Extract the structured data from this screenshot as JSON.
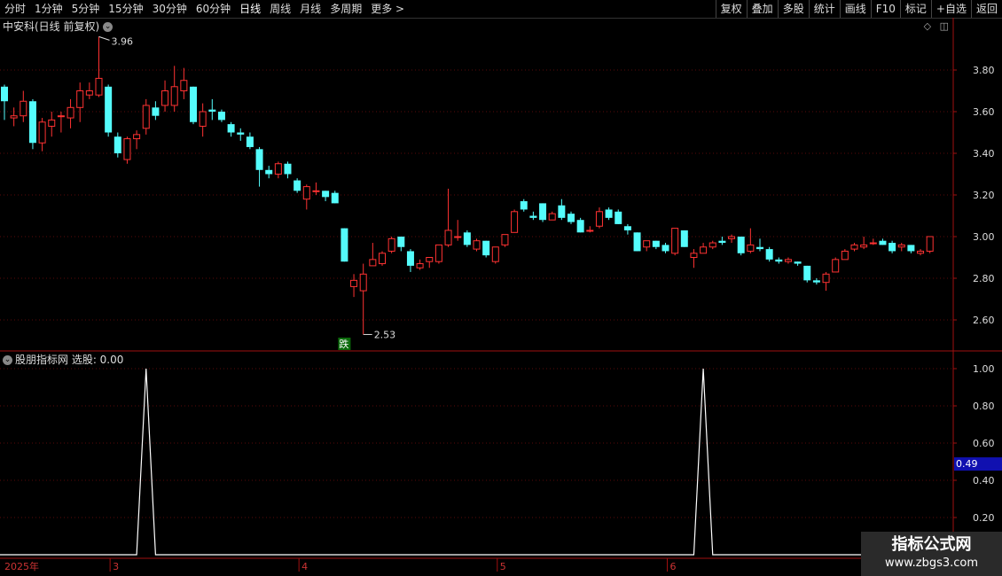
{
  "toolbar": {
    "left_items": [
      "分时",
      "1分钟",
      "5分钟",
      "15分钟",
      "30分钟",
      "60分钟",
      "日线",
      "周线",
      "月线",
      "多周期",
      "更多 >"
    ],
    "active_index": 6,
    "right_items": [
      "复权",
      "叠加",
      "多股",
      "统计",
      "画线",
      "F10",
      "标记",
      "+自选",
      "返回"
    ]
  },
  "main_chart": {
    "title": "中安科(日线 前复权)",
    "high_label": "3.96",
    "low_label": "2.53",
    "signal_label": "跌",
    "y_ticks": [
      "3.80",
      "3.60",
      "3.40",
      "3.20",
      "3.00",
      "2.80",
      "2.60"
    ],
    "up_color": "#ff3232",
    "down_color": "#54fcfc",
    "candles": [
      [
        3.72,
        3.65,
        3.73,
        3.56
      ],
      [
        3.57,
        3.58,
        3.62,
        3.53
      ],
      [
        3.58,
        3.65,
        3.7,
        3.55
      ],
      [
        3.65,
        3.45,
        3.66,
        3.42
      ],
      [
        3.45,
        3.55,
        3.57,
        3.41
      ],
      [
        3.53,
        3.56,
        3.6,
        3.48
      ],
      [
        3.58,
        3.58,
        3.6,
        3.5
      ],
      [
        3.57,
        3.62,
        3.66,
        3.52
      ],
      [
        3.62,
        3.7,
        3.74,
        3.55
      ],
      [
        3.68,
        3.7,
        3.74,
        3.66
      ],
      [
        3.68,
        3.76,
        3.96,
        3.67
      ],
      [
        3.72,
        3.5,
        3.73,
        3.48
      ],
      [
        3.48,
        3.4,
        3.5,
        3.38
      ],
      [
        3.37,
        3.47,
        3.48,
        3.35
      ],
      [
        3.47,
        3.49,
        3.51,
        3.42
      ],
      [
        3.52,
        3.63,
        3.66,
        3.49
      ],
      [
        3.62,
        3.58,
        3.65,
        3.56
      ],
      [
        3.63,
        3.7,
        3.75,
        3.6
      ],
      [
        3.63,
        3.72,
        3.82,
        3.6
      ],
      [
        3.7,
        3.75,
        3.81,
        3.66
      ],
      [
        3.72,
        3.55,
        3.72,
        3.54
      ],
      [
        3.53,
        3.6,
        3.64,
        3.48
      ],
      [
        3.61,
        3.6,
        3.66,
        3.56
      ],
      [
        3.6,
        3.56,
        3.61,
        3.55
      ],
      [
        3.54,
        3.5,
        3.55,
        3.48
      ],
      [
        3.5,
        3.49,
        3.52,
        3.46
      ],
      [
        3.48,
        3.43,
        3.5,
        3.42
      ],
      [
        3.42,
        3.32,
        3.43,
        3.24
      ],
      [
        3.32,
        3.3,
        3.34,
        3.28
      ],
      [
        3.3,
        3.35,
        3.36,
        3.28
      ],
      [
        3.35,
        3.3,
        3.36,
        3.28
      ],
      [
        3.27,
        3.22,
        3.28,
        3.21
      ],
      [
        3.18,
        3.24,
        3.25,
        3.13
      ],
      [
        3.22,
        3.22,
        3.26,
        3.2
      ],
      [
        3.22,
        3.19,
        3.22,
        3.17
      ],
      [
        3.21,
        3.16,
        3.22,
        3.16
      ],
      [
        3.04,
        2.88,
        3.04,
        2.88
      ],
      [
        2.76,
        2.79,
        2.82,
        2.71
      ],
      [
        2.74,
        2.82,
        2.87,
        2.53
      ],
      [
        2.86,
        2.89,
        2.97,
        2.86
      ],
      [
        2.87,
        2.92,
        2.93,
        2.86
      ],
      [
        2.93,
        2.99,
        3.0,
        2.92
      ],
      [
        3.0,
        2.95,
        3.0,
        2.93
      ],
      [
        2.93,
        2.86,
        2.94,
        2.83
      ],
      [
        2.85,
        2.87,
        2.89,
        2.84
      ],
      [
        2.88,
        2.9,
        2.9,
        2.85
      ],
      [
        2.88,
        2.96,
        2.96,
        2.87
      ],
      [
        2.96,
        3.03,
        3.23,
        2.95
      ],
      [
        3.0,
        3.0,
        3.08,
        2.98
      ],
      [
        3.02,
        2.96,
        3.03,
        2.95
      ],
      [
        2.94,
        2.98,
        2.99,
        2.93
      ],
      [
        2.98,
        2.91,
        2.98,
        2.9
      ],
      [
        2.88,
        2.95,
        2.95,
        2.87
      ],
      [
        2.96,
        3.01,
        3.01,
        2.95
      ],
      [
        3.02,
        3.12,
        3.13,
        3.02
      ],
      [
        3.17,
        3.13,
        3.18,
        3.12
      ],
      [
        3.1,
        3.09,
        3.12,
        3.08
      ],
      [
        3.16,
        3.08,
        3.16,
        3.07
      ],
      [
        3.08,
        3.11,
        3.12,
        3.08
      ],
      [
        3.15,
        3.09,
        3.18,
        3.08
      ],
      [
        3.11,
        3.07,
        3.12,
        3.06
      ],
      [
        3.08,
        3.02,
        3.09,
        3.02
      ],
      [
        3.03,
        3.03,
        3.05,
        3.02
      ],
      [
        3.05,
        3.12,
        3.14,
        3.04
      ],
      [
        3.13,
        3.09,
        3.14,
        3.08
      ],
      [
        3.12,
        3.06,
        3.13,
        3.06
      ],
      [
        3.05,
        3.03,
        3.06,
        3.01
      ],
      [
        3.02,
        2.93,
        3.02,
        2.93
      ],
      [
        2.95,
        2.98,
        2.98,
        2.93
      ],
      [
        2.98,
        2.95,
        2.98,
        2.94
      ],
      [
        2.96,
        2.93,
        2.97,
        2.92
      ],
      [
        2.92,
        3.04,
        3.04,
        2.91
      ],
      [
        3.03,
        2.95,
        3.03,
        2.95
      ],
      [
        2.9,
        2.92,
        2.94,
        2.85
      ],
      [
        2.92,
        2.95,
        2.97,
        2.92
      ],
      [
        2.95,
        2.97,
        2.98,
        2.94
      ],
      [
        2.98,
        2.97,
        3.0,
        2.96
      ],
      [
        2.99,
        3.0,
        3.01,
        2.97
      ],
      [
        3.0,
        2.92,
        3.0,
        2.91
      ],
      [
        2.93,
        2.96,
        3.04,
        2.92
      ],
      [
        2.95,
        2.94,
        2.99,
        2.93
      ],
      [
        2.94,
        2.89,
        2.95,
        2.88
      ],
      [
        2.89,
        2.88,
        2.9,
        2.87
      ],
      [
        2.88,
        2.89,
        2.9,
        2.87
      ],
      [
        2.88,
        2.87,
        2.88,
        2.86
      ],
      [
        2.86,
        2.79,
        2.86,
        2.78
      ],
      [
        2.79,
        2.78,
        2.8,
        2.77
      ],
      [
        2.78,
        2.82,
        2.83,
        2.74
      ],
      [
        2.83,
        2.89,
        2.9,
        2.83
      ],
      [
        2.89,
        2.93,
        2.94,
        2.89
      ],
      [
        2.94,
        2.96,
        2.97,
        2.93
      ],
      [
        2.95,
        2.96,
        3.0,
        2.94
      ],
      [
        2.97,
        2.97,
        2.99,
        2.96
      ],
      [
        2.98,
        2.96,
        2.99,
        2.96
      ],
      [
        2.97,
        2.93,
        2.98,
        2.92
      ],
      [
        2.95,
        2.96,
        2.97,
        2.93
      ],
      [
        2.96,
        2.93,
        2.96,
        2.92
      ],
      [
        2.92,
        2.93,
        2.94,
        2.91
      ],
      [
        2.93,
        3.0,
        3.0,
        2.92
      ]
    ]
  },
  "indicator": {
    "title": "股朋指标网 选股: 0.00",
    "y_ticks": [
      "1.00",
      "0.80",
      "0.60",
      "0.40",
      "0.20"
    ],
    "cursor_value": "0.49",
    "signal_bars": [
      15,
      74
    ]
  },
  "axis": {
    "year_label": "2025年",
    "month_labels": [
      "3",
      "4",
      "5",
      "6"
    ],
    "month_bar_index": [
      11,
      31,
      52,
      70
    ]
  },
  "watermark": {
    "title": "指标公式网",
    "url": "www.zbgs3.com"
  }
}
